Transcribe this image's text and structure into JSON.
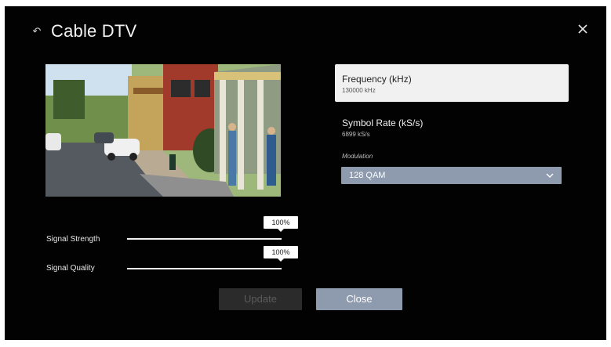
{
  "header": {
    "title": "Cable DTV"
  },
  "fields": {
    "frequency": {
      "label": "Frequency (kHz)",
      "value": "130000 kHz"
    },
    "symbol_rate": {
      "label": "Symbol Rate (kS/s)",
      "value": "6899 kS/s"
    },
    "modulation": {
      "label": "Modulation",
      "selected": "128 QAM"
    }
  },
  "signal": {
    "strength": {
      "label": "Signal Strength",
      "percent_text": "100%",
      "level": 1.0
    },
    "quality": {
      "label": "Signal Quality",
      "percent_text": "100%",
      "level": 1.0
    }
  },
  "buttons": {
    "update_label": "Update",
    "close_label": "Close"
  },
  "icons": {
    "back": "back-arrow-icon",
    "close": "close-icon",
    "dropdown": "chevron-down-icon"
  },
  "colors": {
    "accent": "#8e9aae",
    "card": "#f1f1f1",
    "background": "#020202"
  }
}
